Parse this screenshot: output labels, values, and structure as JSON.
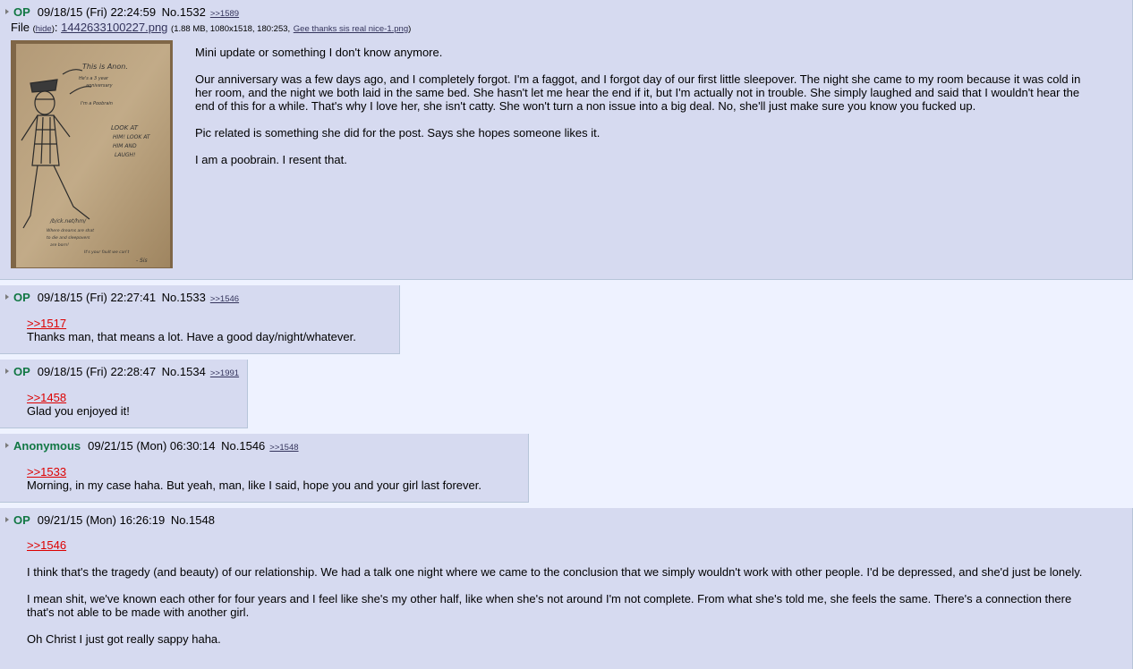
{
  "posts": [
    {
      "name": "OP",
      "date": "09/18/15 (Fri) 22:24:59",
      "no": "No.1532",
      "backlink": ">>1589",
      "file": {
        "prefix": "File",
        "hide": "hide",
        "filename": "1442633100227.png",
        "meta": "(1.88 MB, 1080x1518, 180:253,",
        "orig_name": "Gee thanks sis real nice-1.png"
      },
      "paragraphs": [
        "Mini update or something I don't know anymore.",
        "Our anniversary was a few days ago, and I completely forgot. I'm a faggot, and I forgot day of our first little sleepover. The night she came to my room because it was cold in her room, and the night we both laid in the same bed. She hasn't let me hear the end if it, but I'm actually not in trouble. She simply laughed and said that I wouldn't hear the end of this for a while. That's why I love her, she isn't catty. She won't turn a non issue into a big deal. No, she'll just make sure you know you fucked up.",
        "Pic related is something she did for the post. Says she hopes someone likes it.",
        "I am a poobrain. I resent that."
      ]
    },
    {
      "name": "OP",
      "date": "09/18/15 (Fri) 22:27:41",
      "no": "No.1533",
      "backlink": ">>1546",
      "quote": ">>1517",
      "paragraphs": [
        "Thanks man, that means a lot. Have a good day/night/whatever."
      ]
    },
    {
      "name": "OP",
      "date": "09/18/15 (Fri) 22:28:47",
      "no": "No.1534",
      "backlink": ">>1991",
      "quote": ">>1458",
      "paragraphs": [
        "Glad you enjoyed it!"
      ]
    },
    {
      "name": "Anonymous",
      "date": "09/21/15 (Mon) 06:30:14",
      "no": "No.1546",
      "backlink": ">>1548",
      "quote": ">>1533",
      "paragraphs": [
        "Morning, in my case haha. But yeah, man, like I said, hope you and your girl last forever."
      ]
    },
    {
      "name": "OP",
      "date": "09/21/15 (Mon) 16:26:19",
      "no": "No.1548",
      "quote": ">>1546",
      "paragraphs": [
        "I think that's the tragedy (and beauty) of our relationship. We had a talk one night where we came to the conclusion that we simply wouldn't work with other people. I'd be depressed, and she'd just be lonely.",
        "I mean shit, we've known each other for four years and I feel like she's my other half, like when she's not around I'm not complete. From what she's told me, she feels the same. There's a connection there that's not able to be made with another girl.",
        "Oh Christ I just got really sappy haha."
      ]
    }
  ],
  "thumbnail_text": {
    "line1": "This is Anon.",
    "line2": "LOOK AT HIM! LOOK AT HIM AND LAUGH!",
    "line3": "/b/ck.net/hm/",
    "line4": "it's your fault we can't"
  },
  "colors": {
    "background": "#eef2ff",
    "post_bg": "#d6daf0",
    "name_green": "#117743",
    "quote_red": "#dd0000",
    "link": "#34345c"
  }
}
